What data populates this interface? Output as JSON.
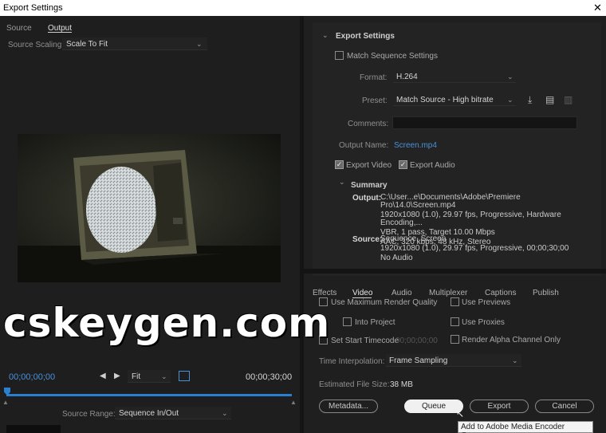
{
  "window": {
    "title": "Export Settings",
    "close_glyph": "✕"
  },
  "left": {
    "tabs": [
      {
        "label": "Source"
      },
      {
        "label": "Output"
      }
    ],
    "source_scaling": {
      "label": "Source Scaling:",
      "value": "Scale To Fit"
    },
    "timecode_start": "00;00;00;00",
    "timecode_end": "00;00;30;00",
    "zoom": {
      "value": "Fit"
    },
    "source_range": {
      "label": "Source Range:",
      "value": "Sequence In/Out"
    }
  },
  "export_settings": {
    "header": "Export Settings",
    "match_sequence": {
      "label": "Match Sequence Settings",
      "checked": false
    },
    "format": {
      "label": "Format:",
      "value": "H.264"
    },
    "preset": {
      "label": "Preset:",
      "value": "Match Source - High bitrate"
    },
    "comments": {
      "label": "Comments:",
      "value": ""
    },
    "output_name": {
      "label": "Output Name:",
      "value": "Screen.mp4"
    },
    "export_video": {
      "label": "Export Video",
      "checked": true
    },
    "export_audio": {
      "label": "Export Audio",
      "checked": true
    },
    "summary": {
      "header": "Summary",
      "output_label": "Output:",
      "output_lines": [
        "C:\\User...e\\Documents\\Adobe\\Premiere Pro\\14.0\\Screen.mp4",
        "1920x1080 (1.0), 29.97 fps, Progressive, Hardware Encoding,...",
        "VBR, 1 pass, Target 10.00 Mbps",
        "AAC, 320 kbps, 48 kHz, Stereo"
      ],
      "source_label": "Source:",
      "source_lines": [
        "Sequence, Screen",
        "1920x1080 (1.0), 29.97 fps, Progressive, 00;00;30;00",
        "No Audio"
      ]
    }
  },
  "bottom_tabs": [
    {
      "label": "Effects"
    },
    {
      "label": "Video"
    },
    {
      "label": "Audio"
    },
    {
      "label": "Multiplexer"
    },
    {
      "label": "Captions"
    },
    {
      "label": "Publish"
    }
  ],
  "options": {
    "max_render_quality": "Use Maximum Render Quality",
    "use_previews": "Use Previews",
    "import_into_project": "Into Project",
    "use_proxies": "Use Proxies",
    "set_start_timecode": "Set Start Timecode",
    "start_timecode_value": "00;00;00;00",
    "render_alpha": "Render Alpha Channel Only",
    "time_interpolation": {
      "label": "Time Interpolation:",
      "value": "Frame Sampling"
    },
    "file_size": {
      "label": "Estimated File Size:",
      "value": "38 MB"
    }
  },
  "buttons": {
    "metadata": "Metadata...",
    "queue": "Queue",
    "export": "Export",
    "cancel": "Cancel"
  },
  "tooltip": "Add to Adobe Media Encoder Queue.",
  "watermark": "cskeygen.com",
  "colors": {
    "accent": "#2b7fd1",
    "link": "#4a90d9"
  }
}
